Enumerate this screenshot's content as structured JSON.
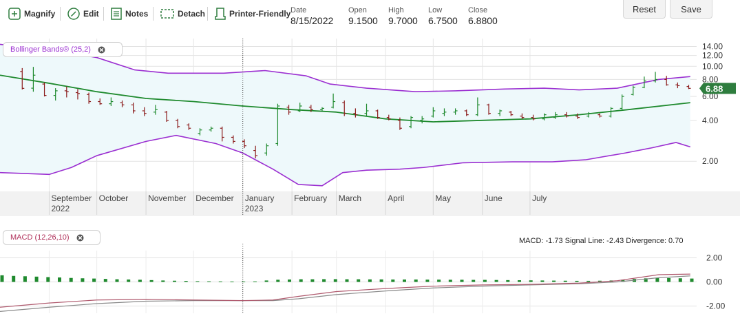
{
  "toolbar": {
    "magnify": "Magnify",
    "edit": "Edit",
    "notes": "Notes",
    "detach": "Detach",
    "printer": "Printer-Friendly",
    "quote": {
      "date_label": "Date",
      "date": "8/15/2022",
      "open_label": "Open",
      "open": "9.1500",
      "high_label": "High",
      "high": "9.7000",
      "low_label": "Low",
      "low": "6.7500",
      "close_label": "Close",
      "close": "6.8800"
    },
    "reset": "Reset",
    "save": "Save"
  },
  "indicators": {
    "bollinger": "Bollinger Bands® (25,2)",
    "macd": "MACD (12,26,10)",
    "macd_readout": "MACD: -1.73 Signal Line: -2.43 Divergence: 0.70"
  },
  "colors": {
    "band": "#9b2fd1",
    "middle": "#1f8a2e",
    "fill": "#eef9fb",
    "up_bar": "#1f8a2e",
    "down_bar": "#8b1a1a",
    "macd_line": "#b05a6e",
    "signal_line": "#8a8a8a",
    "hist": "#1f8a2e",
    "last_price_bg": "#2e7d3e"
  },
  "chart_data": [
    {
      "type": "ohlc",
      "name": "price",
      "log_scale": true,
      "ylim": [
        1.2,
        16
      ],
      "yticks": [
        "14.00",
        "12.00",
        "10.00",
        "8.00",
        "6.00",
        "4.00",
        "2.00"
      ],
      "ytick_values": [
        14,
        12,
        10,
        8,
        6,
        4,
        2
      ],
      "month_labels": [
        {
          "label": "September",
          "sub": "2022",
          "date": "2022-09-01"
        },
        {
          "label": "October",
          "sub": "",
          "date": "2022-10-01"
        },
        {
          "label": "November",
          "sub": "",
          "date": "2022-11-01"
        },
        {
          "label": "December",
          "sub": "",
          "date": "2022-12-01"
        },
        {
          "label": "January",
          "sub": "2023",
          "date": "2023-01-01"
        },
        {
          "label": "February",
          "sub": "",
          "date": "2023-02-01"
        },
        {
          "label": "March",
          "sub": "",
          "date": "2023-03-01"
        },
        {
          "label": "April",
          "sub": "",
          "date": "2023-04-01"
        },
        {
          "label": "May",
          "sub": "",
          "date": "2023-05-01"
        },
        {
          "label": "June",
          "sub": "",
          "date": "2023-06-01"
        },
        {
          "label": "July",
          "sub": "",
          "date": "2023-07-01"
        }
      ],
      "last_price": "6.88",
      "bars": [
        {
          "d": "2022-08-15",
          "o": 9.15,
          "h": 9.7,
          "l": 6.75,
          "c": 6.88
        },
        {
          "d": "2022-08-22",
          "o": 6.9,
          "h": 9.9,
          "l": 6.5,
          "c": 8.6
        },
        {
          "d": "2022-08-29",
          "o": 7.4,
          "h": 7.6,
          "l": 6.0,
          "c": 6.1
        },
        {
          "d": "2022-09-05",
          "o": 6.1,
          "h": 6.9,
          "l": 5.6,
          "c": 6.6
        },
        {
          "d": "2022-09-12",
          "o": 6.6,
          "h": 7.1,
          "l": 5.9,
          "c": 6.5
        },
        {
          "d": "2022-09-19",
          "o": 6.4,
          "h": 6.8,
          "l": 5.7,
          "c": 6.3
        },
        {
          "d": "2022-09-26",
          "o": 6.2,
          "h": 6.4,
          "l": 5.3,
          "c": 5.5
        },
        {
          "d": "2022-10-03",
          "o": 5.5,
          "h": 5.8,
          "l": 5.2,
          "c": 5.3
        },
        {
          "d": "2022-10-10",
          "o": 5.3,
          "h": 5.9,
          "l": 5.1,
          "c": 5.5
        },
        {
          "d": "2022-10-17",
          "o": 5.4,
          "h": 5.6,
          "l": 5.0,
          "c": 5.2
        },
        {
          "d": "2022-10-24",
          "o": 5.2,
          "h": 5.4,
          "l": 4.5,
          "c": 4.7
        },
        {
          "d": "2022-10-31",
          "o": 4.7,
          "h": 5.0,
          "l": 4.3,
          "c": 4.5
        },
        {
          "d": "2022-11-07",
          "o": 4.6,
          "h": 5.2,
          "l": 4.4,
          "c": 4.8
        },
        {
          "d": "2022-11-14",
          "o": 4.6,
          "h": 4.7,
          "l": 3.9,
          "c": 4.0
        },
        {
          "d": "2022-11-21",
          "o": 4.0,
          "h": 4.1,
          "l": 3.5,
          "c": 3.6
        },
        {
          "d": "2022-11-28",
          "o": 3.7,
          "h": 3.8,
          "l": 3.4,
          "c": 3.5
        },
        {
          "d": "2022-12-05",
          "o": 3.2,
          "h": 3.5,
          "l": 3.1,
          "c": 3.4
        },
        {
          "d": "2022-12-12",
          "o": 3.4,
          "h": 3.6,
          "l": 3.3,
          "c": 3.5
        },
        {
          "d": "2022-12-19",
          "o": 3.5,
          "h": 3.6,
          "l": 2.8,
          "c": 3.0
        },
        {
          "d": "2022-12-26",
          "o": 3.0,
          "h": 3.1,
          "l": 2.7,
          "c": 2.8
        },
        {
          "d": "2023-01-02",
          "o": 2.8,
          "h": 2.9,
          "l": 2.5,
          "c": 2.6
        },
        {
          "d": "2023-01-09",
          "o": 2.4,
          "h": 2.6,
          "l": 2.1,
          "c": 2.2
        },
        {
          "d": "2023-01-16",
          "o": 2.3,
          "h": 2.7,
          "l": 2.2,
          "c": 2.6
        },
        {
          "d": "2023-01-23",
          "o": 2.7,
          "h": 5.3,
          "l": 2.6,
          "c": 5.1
        },
        {
          "d": "2023-01-30",
          "o": 5.0,
          "h": 5.2,
          "l": 4.4,
          "c": 4.6
        },
        {
          "d": "2023-02-06",
          "o": 4.7,
          "h": 5.4,
          "l": 4.6,
          "c": 5.1
        },
        {
          "d": "2023-02-13",
          "o": 5.0,
          "h": 5.2,
          "l": 4.6,
          "c": 4.8
        },
        {
          "d": "2023-02-20",
          "o": 4.8,
          "h": 5.0,
          "l": 4.7,
          "c": 4.9
        },
        {
          "d": "2023-02-27",
          "o": 5.0,
          "h": 6.3,
          "l": 4.9,
          "c": 5.5
        },
        {
          "d": "2023-03-06",
          "o": 5.4,
          "h": 5.6,
          "l": 4.3,
          "c": 4.5
        },
        {
          "d": "2023-03-13",
          "o": 4.5,
          "h": 4.9,
          "l": 4.2,
          "c": 4.4
        },
        {
          "d": "2023-03-20",
          "o": 4.5,
          "h": 5.3,
          "l": 4.3,
          "c": 4.7
        },
        {
          "d": "2023-03-27",
          "o": 4.7,
          "h": 4.8,
          "l": 4.1,
          "c": 4.2
        },
        {
          "d": "2023-04-03",
          "o": 4.2,
          "h": 4.4,
          "l": 4.0,
          "c": 4.1
        },
        {
          "d": "2023-04-10",
          "o": 4.0,
          "h": 4.2,
          "l": 3.4,
          "c": 3.5
        },
        {
          "d": "2023-04-17",
          "o": 3.6,
          "h": 4.3,
          "l": 3.5,
          "c": 4.2
        },
        {
          "d": "2023-04-24",
          "o": 4.0,
          "h": 4.3,
          "l": 3.8,
          "c": 4.1
        },
        {
          "d": "2023-05-01",
          "o": 4.3,
          "h": 5.0,
          "l": 4.2,
          "c": 4.7
        },
        {
          "d": "2023-05-08",
          "o": 4.5,
          "h": 4.9,
          "l": 4.3,
          "c": 4.6
        },
        {
          "d": "2023-05-15",
          "o": 4.6,
          "h": 4.9,
          "l": 4.4,
          "c": 4.7
        },
        {
          "d": "2023-05-22",
          "o": 4.7,
          "h": 4.8,
          "l": 4.3,
          "c": 4.4
        },
        {
          "d": "2023-05-29",
          "o": 4.4,
          "h": 5.9,
          "l": 4.3,
          "c": 5.2
        },
        {
          "d": "2023-06-05",
          "o": 5.2,
          "h": 5.3,
          "l": 4.4,
          "c": 4.5
        },
        {
          "d": "2023-06-12",
          "o": 4.5,
          "h": 4.8,
          "l": 4.3,
          "c": 4.7
        },
        {
          "d": "2023-06-19",
          "o": 4.6,
          "h": 4.7,
          "l": 4.3,
          "c": 4.4
        },
        {
          "d": "2023-06-26",
          "o": 4.3,
          "h": 4.5,
          "l": 4.1,
          "c": 4.2
        },
        {
          "d": "2023-07-03",
          "o": 4.2,
          "h": 4.4,
          "l": 4.0,
          "c": 4.1
        },
        {
          "d": "2023-07-10",
          "o": 4.1,
          "h": 4.5,
          "l": 4.0,
          "c": 4.4
        },
        {
          "d": "2023-07-17",
          "o": 4.2,
          "h": 4.6,
          "l": 4.1,
          "c": 4.4
        },
        {
          "d": "2023-07-24",
          "o": 4.4,
          "h": 4.6,
          "l": 4.2,
          "c": 4.3
        },
        {
          "d": "2023-07-31",
          "o": 4.3,
          "h": 4.5,
          "l": 4.1,
          "c": 4.2
        },
        {
          "d": "2023-08-07",
          "o": 4.3,
          "h": 4.6,
          "l": 4.2,
          "c": 4.5
        },
        {
          "d": "2023-08-14",
          "o": 4.4,
          "h": 4.5,
          "l": 4.2,
          "c": 4.3
        },
        {
          "d": "2023-08-21",
          "o": 4.3,
          "h": 5.0,
          "l": 4.2,
          "c": 4.9
        },
        {
          "d": "2023-08-28",
          "o": 4.9,
          "h": 6.2,
          "l": 4.8,
          "c": 6.0
        },
        {
          "d": "2023-09-04",
          "o": 6.2,
          "h": 7.2,
          "l": 6.1,
          "c": 7.0
        },
        {
          "d": "2023-09-11",
          "o": 7.0,
          "h": 8.4,
          "l": 6.9,
          "c": 7.8
        },
        {
          "d": "2023-09-18",
          "o": 7.8,
          "h": 9.1,
          "l": 7.6,
          "c": 8.0
        },
        {
          "d": "2023-09-25",
          "o": 8.0,
          "h": 8.5,
          "l": 7.2,
          "c": 7.3
        },
        {
          "d": "2023-10-02",
          "o": 7.3,
          "h": 7.6,
          "l": 6.9,
          "c": 7.2
        },
        {
          "d": "2023-10-09",
          "o": 7.1,
          "h": 7.3,
          "l": 6.8,
          "c": 6.88
        }
      ],
      "upper_band": [
        {
          "d": "2022-08-01",
          "v": 14.5
        },
        {
          "d": "2022-09-01",
          "v": 13.3
        },
        {
          "d": "2022-10-01",
          "v": 11.6
        },
        {
          "d": "2022-10-25",
          "v": 9.4
        },
        {
          "d": "2022-11-15",
          "v": 8.9
        },
        {
          "d": "2022-12-20",
          "v": 8.9
        },
        {
          "d": "2023-01-15",
          "v": 9.3
        },
        {
          "d": "2023-02-10",
          "v": 8.5
        },
        {
          "d": "2023-02-25",
          "v": 7.4
        },
        {
          "d": "2023-03-20",
          "v": 6.9
        },
        {
          "d": "2023-04-20",
          "v": 6.5
        },
        {
          "d": "2023-05-15",
          "v": 6.6
        },
        {
          "d": "2023-06-15",
          "v": 6.8
        },
        {
          "d": "2023-07-10",
          "v": 6.9
        },
        {
          "d": "2023-08-01",
          "v": 6.7
        },
        {
          "d": "2023-08-25",
          "v": 6.9
        },
        {
          "d": "2023-09-20",
          "v": 8.0
        },
        {
          "d": "2023-10-10",
          "v": 8.4
        }
      ],
      "lower_band": [
        {
          "d": "2022-08-01",
          "v": 1.65
        },
        {
          "d": "2022-09-01",
          "v": 1.6
        },
        {
          "d": "2022-09-15",
          "v": 1.8
        },
        {
          "d": "2022-10-01",
          "v": 2.2
        },
        {
          "d": "2022-11-01",
          "v": 2.8
        },
        {
          "d": "2022-11-20",
          "v": 3.1
        },
        {
          "d": "2022-12-15",
          "v": 2.7
        },
        {
          "d": "2023-01-01",
          "v": 2.3
        },
        {
          "d": "2023-01-20",
          "v": 1.75
        },
        {
          "d": "2023-02-05",
          "v": 1.35
        },
        {
          "d": "2023-02-20",
          "v": 1.32
        },
        {
          "d": "2023-03-05",
          "v": 1.65
        },
        {
          "d": "2023-03-20",
          "v": 1.72
        },
        {
          "d": "2023-04-10",
          "v": 1.75
        },
        {
          "d": "2023-04-25",
          "v": 1.8
        },
        {
          "d": "2023-05-20",
          "v": 1.95
        },
        {
          "d": "2023-06-20",
          "v": 1.98
        },
        {
          "d": "2023-07-15",
          "v": 1.98
        },
        {
          "d": "2023-08-05",
          "v": 2.05
        },
        {
          "d": "2023-08-30",
          "v": 2.3
        },
        {
          "d": "2023-09-15",
          "v": 2.5
        },
        {
          "d": "2023-10-01",
          "v": 2.75
        },
        {
          "d": "2023-10-10",
          "v": 2.55
        }
      ],
      "middle_band": [
        {
          "d": "2022-08-01",
          "v": 8.6
        },
        {
          "d": "2022-09-01",
          "v": 7.5
        },
        {
          "d": "2022-10-01",
          "v": 6.5
        },
        {
          "d": "2022-11-01",
          "v": 5.8
        },
        {
          "d": "2022-12-01",
          "v": 5.5
        },
        {
          "d": "2023-01-01",
          "v": 5.1
        },
        {
          "d": "2023-02-01",
          "v": 4.8
        },
        {
          "d": "2023-03-01",
          "v": 4.6
        },
        {
          "d": "2023-04-01",
          "v": 4.1
        },
        {
          "d": "2023-05-01",
          "v": 3.9
        },
        {
          "d": "2023-06-01",
          "v": 4.0
        },
        {
          "d": "2023-07-01",
          "v": 4.1
        },
        {
          "d": "2023-08-01",
          "v": 4.4
        },
        {
          "d": "2023-09-01",
          "v": 4.8
        },
        {
          "d": "2023-10-10",
          "v": 5.4
        }
      ]
    },
    {
      "type": "line",
      "name": "macd",
      "ylim": [
        -2.6,
        2.6
      ],
      "yticks": [
        "2.00",
        "0.00",
        "-2.00"
      ],
      "ytick_values": [
        2,
        0,
        -2
      ],
      "macd_line": [
        {
          "d": "2022-08-01",
          "v": -2.1
        },
        {
          "d": "2022-09-01",
          "v": -1.75
        },
        {
          "d": "2022-10-01",
          "v": -1.5
        },
        {
          "d": "2022-11-01",
          "v": -1.45
        },
        {
          "d": "2022-12-01",
          "v": -1.5
        },
        {
          "d": "2023-01-01",
          "v": -1.55
        },
        {
          "d": "2023-01-20",
          "v": -1.5
        },
        {
          "d": "2023-02-05",
          "v": -1.2
        },
        {
          "d": "2023-03-01",
          "v": -0.8
        },
        {
          "d": "2023-04-01",
          "v": -0.55
        },
        {
          "d": "2023-05-01",
          "v": -0.35
        },
        {
          "d": "2023-06-01",
          "v": -0.25
        },
        {
          "d": "2023-07-01",
          "v": -0.2
        },
        {
          "d": "2023-08-01",
          "v": -0.1
        },
        {
          "d": "2023-08-25",
          "v": 0.1
        },
        {
          "d": "2023-09-20",
          "v": 0.6
        },
        {
          "d": "2023-10-10",
          "v": 0.65
        }
      ],
      "signal_line": [
        {
          "d": "2022-08-01",
          "v": -2.45
        },
        {
          "d": "2022-09-01",
          "v": -2.1
        },
        {
          "d": "2022-10-01",
          "v": -1.8
        },
        {
          "d": "2022-11-01",
          "v": -1.6
        },
        {
          "d": "2022-12-01",
          "v": -1.55
        },
        {
          "d": "2023-01-01",
          "v": -1.55
        },
        {
          "d": "2023-01-20",
          "v": -1.55
        },
        {
          "d": "2023-02-05",
          "v": -1.4
        },
        {
          "d": "2023-03-01",
          "v": -1.05
        },
        {
          "d": "2023-04-01",
          "v": -0.75
        },
        {
          "d": "2023-05-01",
          "v": -0.5
        },
        {
          "d": "2023-06-01",
          "v": -0.35
        },
        {
          "d": "2023-07-01",
          "v": -0.25
        },
        {
          "d": "2023-08-01",
          "v": -0.15
        },
        {
          "d": "2023-08-25",
          "v": 0.0
        },
        {
          "d": "2023-09-20",
          "v": 0.35
        },
        {
          "d": "2023-10-10",
          "v": 0.5
        }
      ],
      "histogram": [
        0.55,
        0.5,
        0.47,
        0.44,
        0.4,
        0.37,
        0.33,
        0.3,
        0.28,
        0.25,
        0.22,
        0.2,
        0.18,
        0.15,
        0.12,
        0.1,
        0.08,
        0.06,
        0.05,
        0.04,
        0.03,
        0.03,
        0.04,
        0.12,
        0.18,
        0.2,
        0.22,
        0.22,
        0.23,
        0.23,
        0.22,
        0.22,
        0.21,
        0.21,
        0.2,
        0.2,
        0.2,
        0.19,
        0.19,
        0.18,
        0.18,
        0.17,
        0.17,
        0.16,
        0.15,
        0.14,
        0.13,
        0.12,
        0.11,
        0.1,
        0.09,
        0.09,
        0.1,
        0.12,
        0.18,
        0.25,
        0.3,
        0.33,
        0.32,
        0.3,
        0.28
      ]
    }
  ]
}
